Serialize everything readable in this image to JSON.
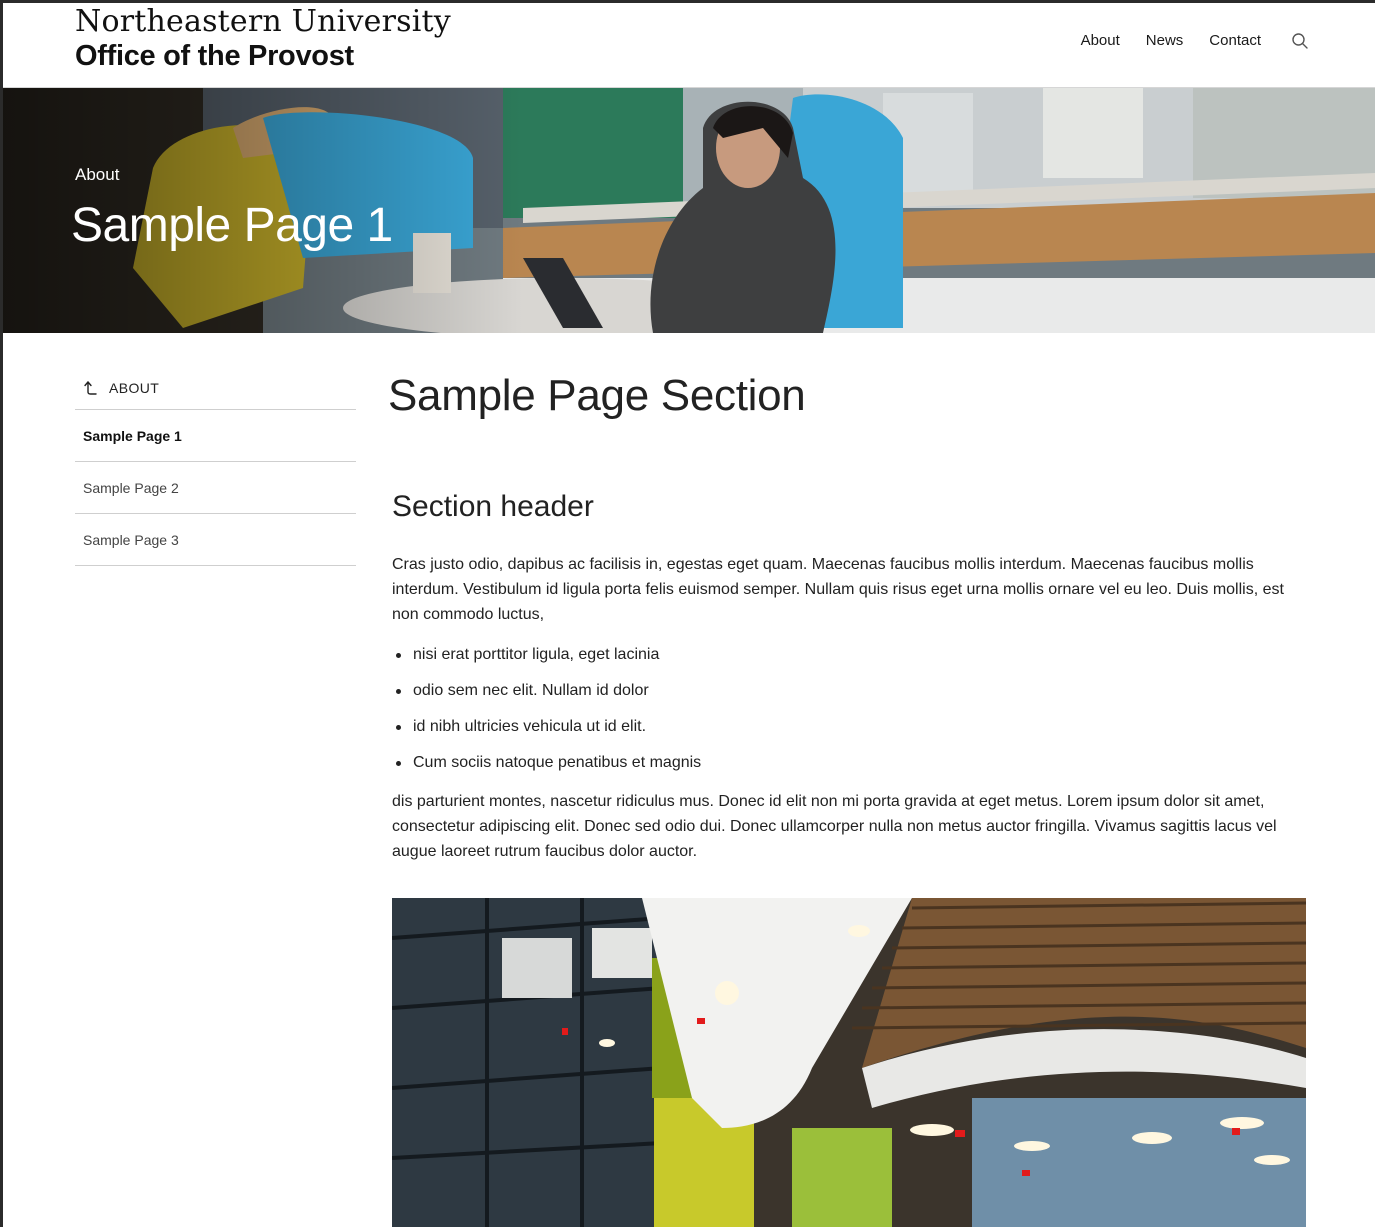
{
  "header": {
    "logo_line1": "Northeastern University",
    "logo_line2": "Office of the Provost",
    "nav": [
      {
        "label": "About"
      },
      {
        "label": "News"
      },
      {
        "label": "Contact"
      }
    ],
    "search_icon": "search-icon"
  },
  "hero": {
    "breadcrumb": "About",
    "title": "Sample Page 1"
  },
  "sidebar": {
    "parent_label": "ABOUT",
    "parent_icon": "arrow-up-left-icon",
    "items": [
      {
        "label": "Sample Page 1",
        "active": true
      },
      {
        "label": "Sample Page 2",
        "active": false
      },
      {
        "label": "Sample Page 3",
        "active": false
      }
    ]
  },
  "main": {
    "page_section_title": "Sample Page Section",
    "section_header": "Section header",
    "paragraph1": "Cras justo odio, dapibus ac facilisis in, egestas eget quam. Maecenas faucibus mollis interdum. Maecenas faucibus mollis interdum. Vestibulum id ligula porta felis euismod semper. Nullam quis risus eget urna mollis ornare vel eu leo. Duis mollis, est non commodo luctus,",
    "bullets": [
      "nisi erat porttitor ligula, eget lacinia",
      "odio sem nec elit. Nullam id dolor",
      "id nibh ultricies vehicula ut id elit.",
      "Cum sociis natoque penatibus et magnis"
    ],
    "paragraph2": "dis parturient montes, nascetur ridiculus mus. Donec id elit non mi porta gravida at eget metus. Lorem ipsum dolor sit amet, consectetur adipiscing elit. Donec sed odio dui. Donec ullamcorper nulla non metus auctor fringilla. Vivamus sagittis lacus vel augue laoreet rutrum faucibus dolor auctor."
  },
  "colors": {
    "text": "#1a1a1a",
    "divider": "#cfcfcf",
    "hero_chair_blue": "#3aa6d6",
    "hero_chair_yellow": "#d6c02a",
    "hero_wood": "#b07a3e"
  }
}
